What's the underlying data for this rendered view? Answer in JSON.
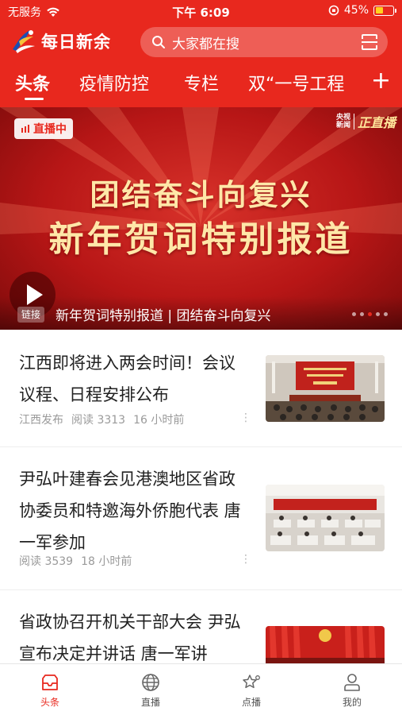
{
  "status_bar": {
    "carrier": "无服务",
    "time": "下午 6:09",
    "battery_percent": "45%",
    "battery_level": 0.45,
    "icons": [
      "wifi-icon",
      "orientation-lock-icon",
      "battery-icon"
    ]
  },
  "app": {
    "name": "每日新余",
    "search_placeholder": "大家都在搜",
    "icons": [
      "logo-icon",
      "search-icon",
      "scan-icon"
    ],
    "accent_color": "#e8281e"
  },
  "tabs": [
    {
      "label": "头条",
      "active": true
    },
    {
      "label": "疫情防控",
      "active": false
    },
    {
      "label": "专栏",
      "active": false
    },
    {
      "label": "双“一号工程",
      "active": false
    }
  ],
  "tab_add_label": "+",
  "banner": {
    "live_label": "直播中",
    "source_small": "央视\n新闻",
    "source_big": "正直播",
    "title_line1": "团结奋斗向复兴",
    "title_line2": "新年贺词特别报道",
    "link_tag": "链接",
    "caption": "新年贺词特别报道 | 团结奋斗向复兴",
    "slide_count": 5,
    "active_slide": 3
  },
  "news": [
    {
      "title": "江西即将进入两会时间！会议议程、日程安排公布",
      "source": "江西发布",
      "reads": "阅读 3313",
      "time": "16 小时前",
      "more": "⋮"
    },
    {
      "title": "尹弘叶建春会见港澳地区省政协委员和特邀海外侨胞代表 唐一军参加",
      "source": "",
      "reads": "阅读 3539",
      "time": "18 小时前",
      "more": "⋮"
    },
    {
      "title": "省政协召开机关干部大会 尹弘宣布决定并讲话 唐一军讲",
      "source": "",
      "reads": "",
      "time": "",
      "more": ""
    }
  ],
  "bottom_nav": [
    {
      "label": "头条",
      "icon": "news-icon",
      "active": true
    },
    {
      "label": "直播",
      "icon": "globe-icon",
      "active": false
    },
    {
      "label": "点播",
      "icon": "star-icon",
      "active": false
    },
    {
      "label": "我的",
      "icon": "user-icon",
      "active": false
    }
  ]
}
